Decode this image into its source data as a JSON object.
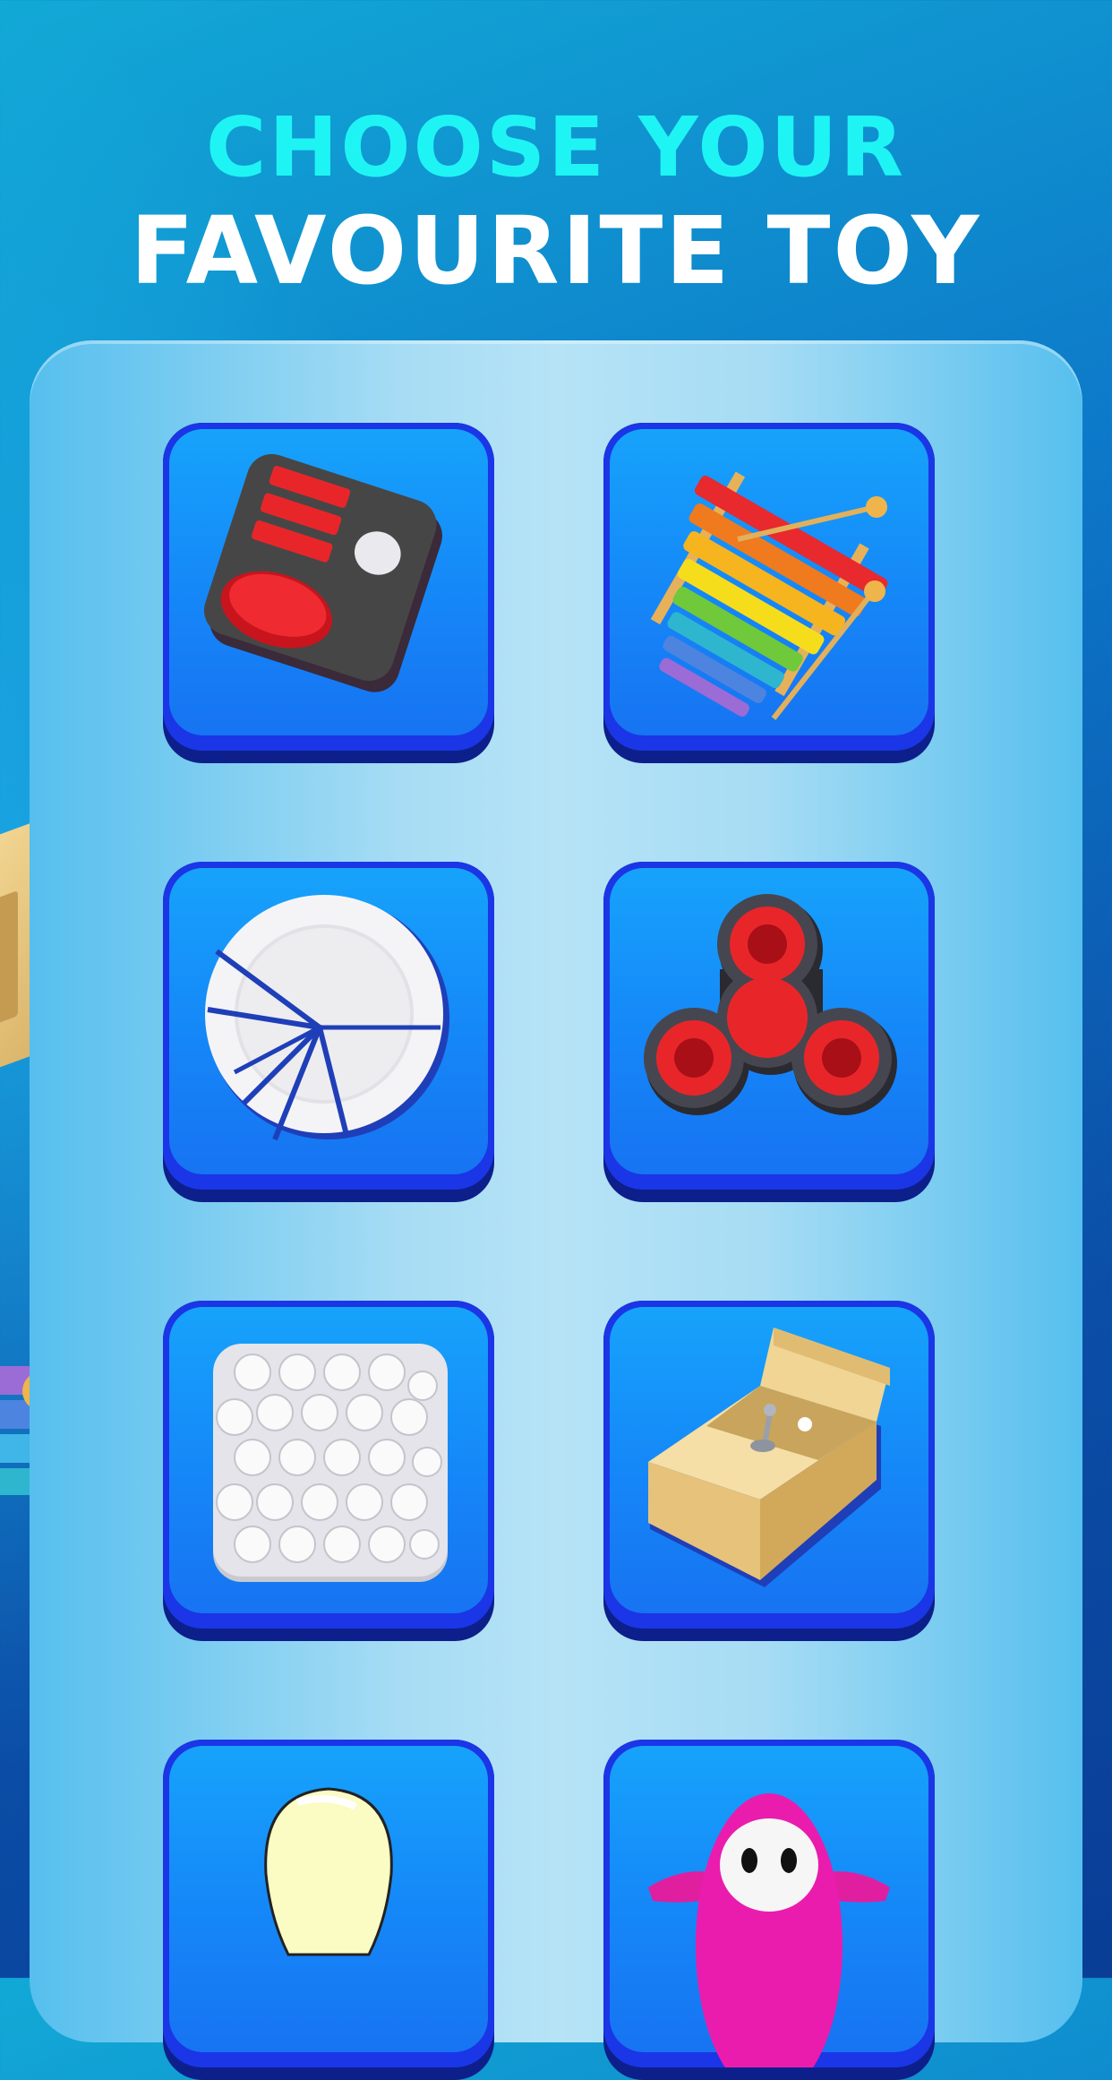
{
  "header": {
    "line1": "CHOOSE YOUR",
    "line2": "FAVOURITE TOY"
  },
  "colors": {
    "title_accent": "#1ff4f4",
    "title_main": "#ffffff",
    "tile_blue": "#1589f8",
    "tile_border": "#1a36e6"
  },
  "toys": [
    {
      "icon": "fidget-cube-icon"
    },
    {
      "icon": "xylophone-icon"
    },
    {
      "icon": "broken-plate-icon"
    },
    {
      "icon": "fidget-spinner-icon"
    },
    {
      "icon": "bubble-wrap-icon"
    },
    {
      "icon": "useless-box-icon"
    },
    {
      "icon": "light-bulb-icon"
    },
    {
      "icon": "jelly-bean-character-icon"
    }
  ]
}
